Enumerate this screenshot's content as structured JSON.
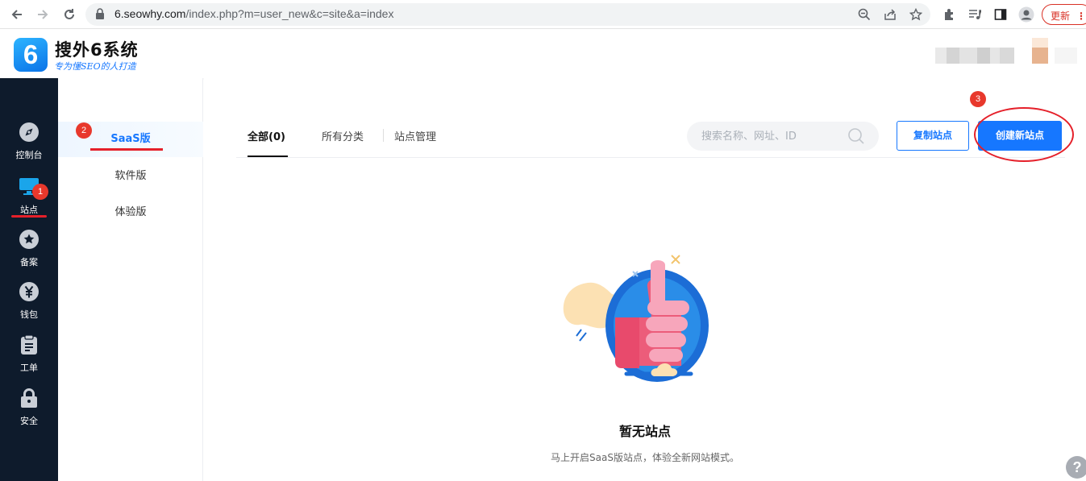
{
  "browser": {
    "url_host": "6.seowhy.com",
    "url_path": "/index.php?m=user_new&c=site&a=index",
    "update_label": "更新"
  },
  "header": {
    "logo_mark": "6",
    "logo_title": "搜外6系统",
    "logo_slogan": "专为懂SEO的人打造"
  },
  "sidebar": {
    "items": [
      {
        "label": "控制台",
        "icon": "compass-icon"
      },
      {
        "label": "站点",
        "icon": "monitor-icon"
      },
      {
        "label": "备案",
        "icon": "star-badge-icon"
      },
      {
        "label": "钱包",
        "icon": "yen-icon"
      },
      {
        "label": "工单",
        "icon": "clipboard-icon"
      },
      {
        "label": "安全",
        "icon": "lock-icon"
      }
    ]
  },
  "subsidebar": {
    "items": [
      {
        "label": "SaaS版",
        "active": true
      },
      {
        "label": "软件版",
        "active": false
      },
      {
        "label": "体验版",
        "active": false
      }
    ]
  },
  "tabs": [
    {
      "label": "全部(0)",
      "active": true
    },
    {
      "label": "所有分类",
      "active": false
    },
    {
      "label": "站点管理",
      "active": false
    }
  ],
  "search": {
    "placeholder": "搜索名称、网址、ID",
    "value": ""
  },
  "buttons": {
    "copy_site": "复制站点",
    "create_site": "创建新站点"
  },
  "empty_state": {
    "title": "暂无站点",
    "description": "马上开启SaaS版站点，体验全新网站模式。"
  },
  "annotations": {
    "marker_1": "1",
    "marker_2": "2",
    "marker_3": "3"
  },
  "help": {
    "label": "?"
  },
  "colors": {
    "primary": "#1677ff",
    "sidebar_bg": "#0e1b2c",
    "annotation_red": "#e5202a"
  }
}
